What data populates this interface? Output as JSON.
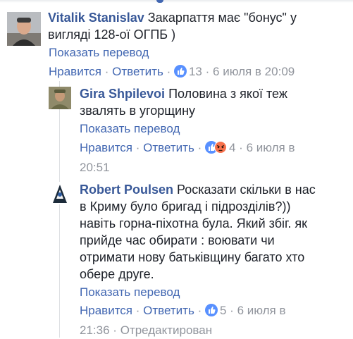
{
  "comments": [
    {
      "author": "Vitalik Stanislav",
      "text_line1": "Закарпаття має \"бонус\" у",
      "text_line2": "вигляді 128-ої ОГПБ )",
      "translate": "Показать перевод",
      "like": "Нравится",
      "reply": "Ответить",
      "reactions": "13",
      "time": "6 июля в 20:09"
    },
    {
      "author": "Gira Shpilevoi",
      "text_line1": "Половина з якої теж",
      "text_line2": "звалять в угорщину",
      "translate": "Показать перевод",
      "like": "Нравится",
      "reply": "Ответить",
      "reactions": "4",
      "time_line1": "6 июля в",
      "time_line2": "20:51"
    },
    {
      "author": "Robert Poulsen",
      "text_line1": "Росказати скільки в нас",
      "text_line2": "в Криму було бригад і підрозділів?))",
      "text_line3": "навіть горна-піхотна була. Який збіг. як",
      "text_line4": "прийде час обирати : воювати чи",
      "text_line5": "отримати нову батьківщину багато хто",
      "text_line6": "обере друге.",
      "translate": "Показать перевод",
      "like": "Нравится",
      "reply": "Ответить",
      "reactions": "5",
      "time_line1": "6 июля в",
      "time_line2": "21:36",
      "edited": "Отредактирован"
    }
  ],
  "separator": "·",
  "colors": {
    "link": "#4267b2",
    "author": "#385898",
    "text": "#1d2129",
    "meta_gray": "#90949c",
    "like_blue": "#5890ff",
    "angry": "#f7714c"
  }
}
